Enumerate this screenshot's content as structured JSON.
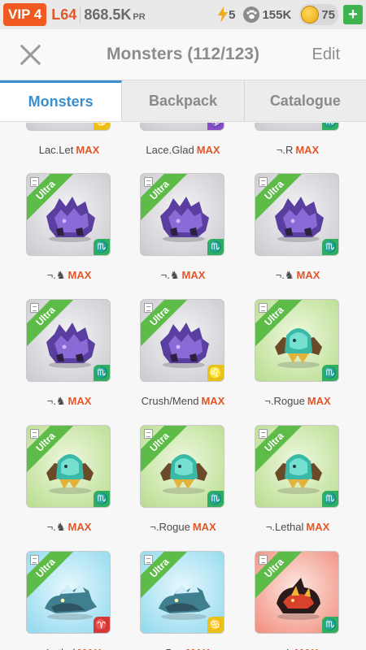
{
  "status": {
    "vip": "VIP 4",
    "level": "L64",
    "pr_value": "868.5K",
    "pr_unit": "PR",
    "energy": "5",
    "food": "155K",
    "gold": "75"
  },
  "header": {
    "title": "Monsters (112/123)",
    "edit": "Edit"
  },
  "tabs": [
    "Monsters",
    "Backpack",
    "Catalogue"
  ],
  "max_label": "MAX",
  "rows": [
    [
      {
        "name": "Lac.Let",
        "sign": "♋",
        "sign_color": "y",
        "bg": "gray"
      },
      {
        "name": "Lace.Glad",
        "sign": "♑",
        "sign_color": "p",
        "bg": "gray"
      },
      {
        "name": "¬.R",
        "sign": "♏",
        "sign_color": "g",
        "bg": "gray"
      }
    ],
    [
      {
        "name": "¬.♞",
        "sign": "♏",
        "sign_color": "g",
        "bg": "gray",
        "badge": "Ultra"
      },
      {
        "name": "¬.♞",
        "sign": "♏",
        "sign_color": "g",
        "bg": "gray",
        "badge": "Ultra"
      },
      {
        "name": "¬.♞",
        "sign": "♏",
        "sign_color": "g",
        "bg": "gray",
        "badge": "Ultra"
      }
    ],
    [
      {
        "name": "¬.♞",
        "sign": "♏",
        "sign_color": "g",
        "bg": "gray",
        "badge": "Ultra"
      },
      {
        "name": "Crush/Mend",
        "sign": "♌",
        "sign_color": "y",
        "bg": "gray",
        "badge": "Ultra"
      },
      {
        "name": "¬.Rogue",
        "sign": "♏",
        "sign_color": "g",
        "bg": "green",
        "badge": "Ultra"
      }
    ],
    [
      {
        "name": "¬.♞",
        "sign": "♏",
        "sign_color": "g",
        "bg": "green",
        "badge": "Ultra"
      },
      {
        "name": "¬.Rogue",
        "sign": "♏",
        "sign_color": "g",
        "bg": "green",
        "badge": "Ultra"
      },
      {
        "name": "¬.Lethal",
        "sign": "♏",
        "sign_color": "g",
        "bg": "green",
        "badge": "Ultra"
      }
    ],
    [
      {
        "name": "¬.Lethal",
        "sign": "♈",
        "sign_color": "r",
        "bg": "cyan",
        "badge": "Ultra"
      },
      {
        "name": "¬.Bas",
        "sign": "♋",
        "sign_color": "y",
        "bg": "cyan",
        "badge": "Ultra"
      },
      {
        "name": "¬.L",
        "sign": "♏",
        "sign_color": "g",
        "bg": "red",
        "badge": "Ultra"
      }
    ]
  ]
}
